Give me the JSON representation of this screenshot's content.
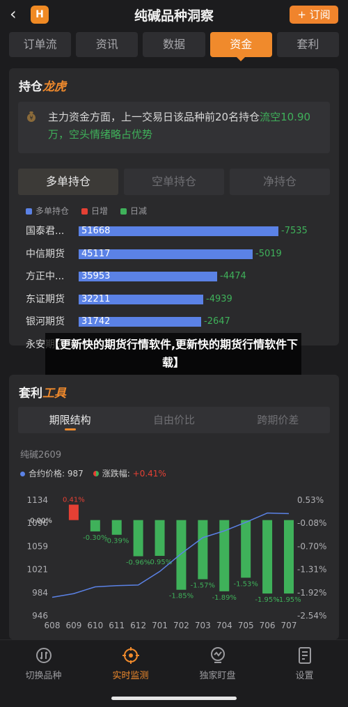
{
  "header": {
    "back_icon": "chevron-left-icon",
    "logo_text": "H",
    "title": "纯碱品种洞察",
    "subscribe_label": "+ 订阅"
  },
  "tabs": [
    {
      "label": "订单流",
      "active": false
    },
    {
      "label": "资讯",
      "active": false
    },
    {
      "label": "数据",
      "active": false
    },
    {
      "label": "资金",
      "active": true
    },
    {
      "label": "套利",
      "active": false
    }
  ],
  "positions": {
    "title_a": "持仓",
    "title_b": "龙虎",
    "note_text": "主力资金方面，上一交易日该品种前20名持仓",
    "note_green": "流空10.90万，空头情绪略占优势",
    "subtabs": [
      "多单持仓",
      "空单持仓",
      "净持仓"
    ],
    "legend": [
      {
        "label": "多单持仓",
        "color": "#5b82e6"
      },
      {
        "label": "日增",
        "color": "#e54034"
      },
      {
        "label": "日减",
        "color": "#3fb15a"
      }
    ],
    "rows": [
      {
        "name": "国泰君...",
        "value": 51668,
        "change": "-7535"
      },
      {
        "name": "中信期货",
        "value": 45117,
        "change": "-5019"
      },
      {
        "name": "方正中...",
        "value": 35953,
        "change": "-4474"
      },
      {
        "name": "东证期货",
        "value": 32211,
        "change": "-4939"
      },
      {
        "name": "银河期货",
        "value": 31742,
        "change": "-2647"
      },
      {
        "name": "永安期货",
        "value": null,
        "change": ""
      }
    ]
  },
  "overlay_text": "【更新快的期货行情软件,更新快的期货行情软件下载】",
  "arbitrage": {
    "title_a": "套利",
    "title_b": "工具",
    "subtabs": [
      "期限结构",
      "自由价比",
      "跨期价差"
    ],
    "contract": "纯碱2609",
    "price_label": "合约价格:",
    "price_value": "987",
    "chg_label": "涨跌幅:",
    "chg_value": "+0.41%"
  },
  "chart_data": {
    "type": "bar",
    "categories": [
      "608",
      "609",
      "610",
      "611",
      "612",
      "701",
      "702",
      "703",
      "704",
      "705",
      "706",
      "707"
    ],
    "change_pct": [
      0.0,
      0.41,
      -0.3,
      -0.39,
      -0.96,
      -0.95,
      -1.85,
      -1.57,
      -1.89,
      -1.53,
      -1.95,
      -1.95
    ],
    "change_labels": [
      "0.00%",
      "0.41%",
      "-0.30%",
      "-0.39%",
      "-0.96%",
      "-0.95%",
      "-1.85%",
      "-1.57%",
      "-1.89%",
      "-1.53%",
      "-1.95%",
      "-1.95%"
    ],
    "price": [
      976,
      982,
      993,
      995,
      996,
      1018,
      1047,
      1073,
      1084,
      1098,
      1113,
      1112
    ],
    "left_ticks": [
      "1134",
      "1096",
      "1059",
      "1021",
      "984",
      "946"
    ],
    "right_ticks": [
      "0.53%",
      "-0.08%",
      "-0.70%",
      "-1.31%",
      "-1.92%",
      "-2.54%"
    ],
    "ylim_price": [
      946,
      1134
    ],
    "ylim_pct": [
      -2.54,
      0.53
    ],
    "colors": {
      "up": "#e54034",
      "down": "#3fb15a",
      "line": "#5b82e6"
    }
  },
  "bottom_nav": [
    {
      "label": "切换品种",
      "icon": "switch-icon",
      "active": false
    },
    {
      "label": "实时监测",
      "icon": "target-icon",
      "active": true
    },
    {
      "label": "独家盯盘",
      "icon": "monitor-icon",
      "active": false
    },
    {
      "label": "设置",
      "icon": "settings-icon",
      "active": false
    }
  ]
}
